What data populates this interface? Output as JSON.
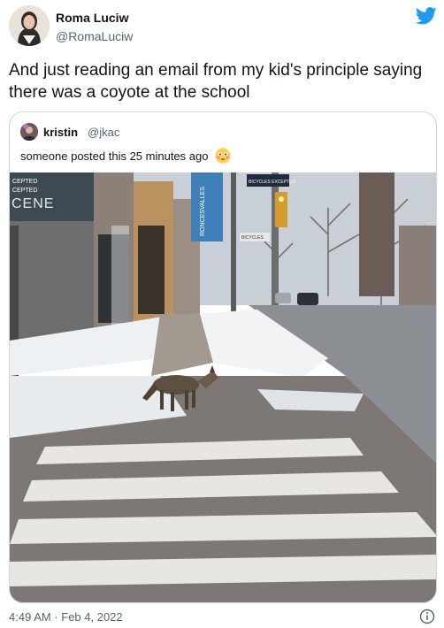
{
  "tweet": {
    "author_name": "Roma Luciw",
    "author_handle": "@RomaLuciw",
    "text": "And just reading an email from my kid's principle saying there was a coyote at the school",
    "timestamp": "4:49 AM · Feb 4, 2022"
  },
  "quoted_tweet": {
    "author_name": "kristin",
    "author_handle": "@jkac",
    "text": "someone posted this 25 minutes ago",
    "emoji": "flushed-face"
  },
  "photo_signs": {
    "store_sign_line1": "CEPTED",
    "store_sign_line2": "CEPTED",
    "store_sign_big": "CENE",
    "banner_text": "RONCESVALLES",
    "street_sign": "BICYCLES EXCEPTED",
    "street_sign2": "BICYCLES"
  },
  "icons": {
    "logo": "twitter-bird-icon",
    "info": "info-icon"
  },
  "colors": {
    "twitter_blue": "#1d9bf0",
    "secondary_text": "#536471",
    "border": "#cfd9de"
  }
}
